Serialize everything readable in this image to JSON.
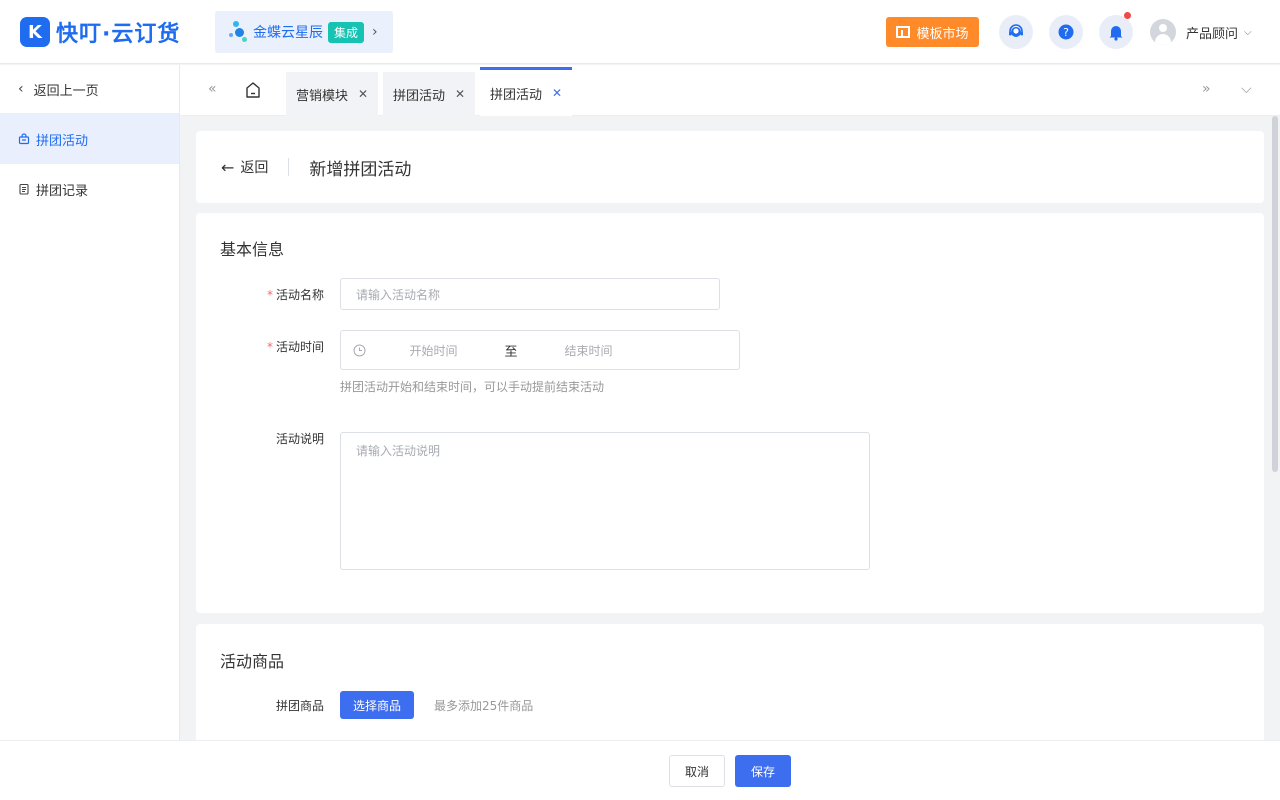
{
  "header": {
    "brand_logo_letter": "K",
    "brand_name": "快叮·云订货",
    "xingchen": {
      "name": "金蝶云星辰",
      "badge": "集成",
      "arrow": "›"
    },
    "template_market_label": "模板市场",
    "user_name": "产品顾问",
    "user_caret": "⌵",
    "icons": [
      "support-icon",
      "help-icon",
      "bell-icon"
    ],
    "has_notification": true
  },
  "sidebar": {
    "back_label": "返回上一页",
    "items": [
      {
        "label": "拼团活动",
        "icon": "group-buy-icon",
        "active": true
      },
      {
        "label": "拼团记录",
        "icon": "record-icon",
        "active": false
      }
    ]
  },
  "tabs": {
    "prev_label": "«",
    "next_label": "»",
    "menu_label": "⌵",
    "items": [
      {
        "label": "营销模块",
        "close": "✕",
        "active": false
      },
      {
        "label": "拼团活动",
        "close": "✕",
        "active": false
      },
      {
        "label": "拼团活动",
        "close": "✕",
        "active": true
      }
    ]
  },
  "page": {
    "back_label": "返回",
    "title": "新增拼团活动"
  },
  "basic_info": {
    "section_title": "基本信息",
    "name_label": "活动名称",
    "name_placeholder": "请输入活动名称",
    "time_label": "活动时间",
    "start_placeholder": "开始时间",
    "range_separator": "至",
    "end_placeholder": "结束时间",
    "time_hint": "拼团活动开始和结束时间，可以手动提前结束活动",
    "desc_label": "活动说明",
    "desc_placeholder": "请输入活动说明",
    "required_mark": "*"
  },
  "goods": {
    "section_title": "活动商品",
    "goods_label": "拼团商品",
    "select_button": "选择商品",
    "limit_hint": "最多添加25件商品"
  },
  "footer": {
    "cancel_label": "取消",
    "save_label": "保存"
  },
  "colors": {
    "primary": "#3d6ef0",
    "brand": "#1f6cf0",
    "template_button": "#ff8a2a",
    "badge": "#16c2b1",
    "required": "#f56c6c",
    "notification_dot": "#f04a45"
  }
}
